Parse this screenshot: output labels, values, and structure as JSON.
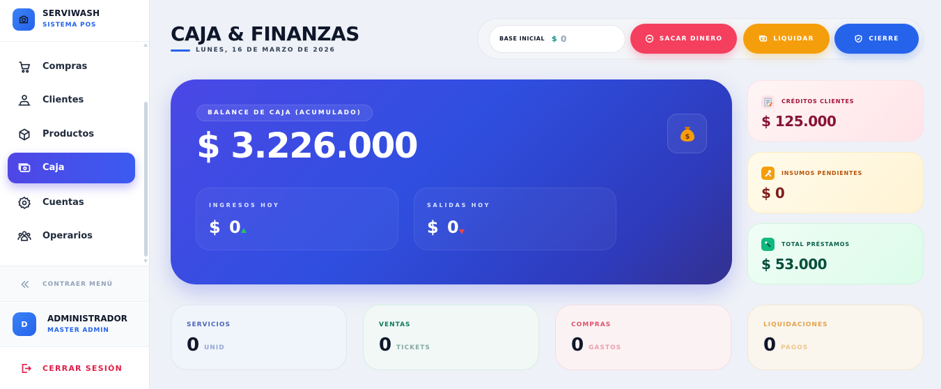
{
  "brand": {
    "name": "SERVIWASH",
    "subtitle": "SISTEMA POS"
  },
  "sidebar": {
    "items": [
      {
        "label": "Compras",
        "icon": "cart-icon"
      },
      {
        "label": "Clientes",
        "icon": "users-icon"
      },
      {
        "label": "Productos",
        "icon": "box-icon"
      },
      {
        "label": "Caja",
        "icon": "cash-icon",
        "active": true
      },
      {
        "label": "Cuentas",
        "icon": "gear-icon"
      },
      {
        "label": "Operarios",
        "icon": "team-icon"
      }
    ],
    "collapse_label": "CONTRAER MENÚ",
    "logout_label": "CERRAR SESIÓN"
  },
  "user": {
    "initial": "D",
    "name": "ADMINISTRADOR",
    "role": "MASTER ADMIN"
  },
  "header": {
    "title": "CAJA & FINANZAS",
    "date": "LUNES, 16 DE MARZO DE 2026"
  },
  "toolbar": {
    "base_label": "BASE INICIAL",
    "base_currency": "$",
    "base_value": "0",
    "withdraw_label": "SACAR DINERO",
    "liquidate_label": "LIQUIDAR",
    "close_label": "CIERRE"
  },
  "balance": {
    "label": "BALANCE DE CAJA (ACUMULADO)",
    "value": "$ 3.226.000",
    "bag_icon": "money-bag-icon",
    "income": {
      "label": "INGRESOS HOY",
      "value": "$ 0"
    },
    "expenses": {
      "label": "SALIDAS HOY",
      "value": "$ 0"
    }
  },
  "side_cards": [
    {
      "label": "CRÉDITOS CLIENTES",
      "value": "$ 125.000",
      "icon": "memo-icon"
    },
    {
      "label": "INSUMOS PENDIENTES",
      "value": "$ 0",
      "icon": "tools-icon"
    },
    {
      "label": "TOTAL PRÉSTAMOS",
      "value": "$ 53.000",
      "icon": "loan-icon"
    }
  ],
  "stats": [
    {
      "label": "SERVICIOS",
      "value": "0",
      "unit": "UNID"
    },
    {
      "label": "VENTAS",
      "value": "0",
      "unit": "TICKETS"
    },
    {
      "label": "COMPRAS",
      "value": "0",
      "unit": "GASTOS"
    },
    {
      "label": "LIQUIDACIONES",
      "value": "0",
      "unit": "PAGOS"
    }
  ],
  "colors": {
    "accent": "#2563eb",
    "danger": "#f43f5e",
    "warning": "#f59e0b",
    "primary": "#4f46e5"
  }
}
